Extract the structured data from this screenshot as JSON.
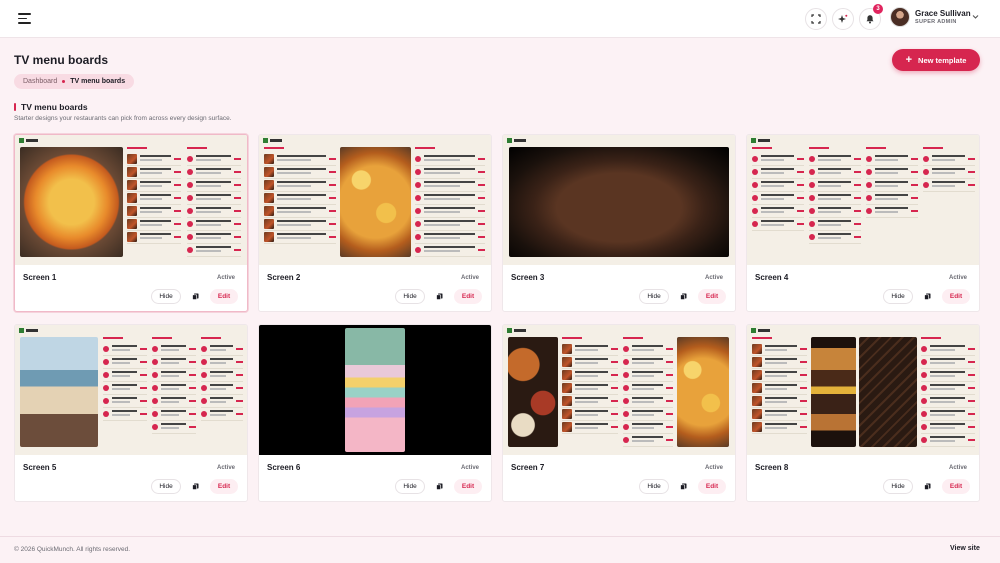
{
  "header": {
    "notification_count": "3",
    "user": {
      "name": "Grace Sullivan",
      "role": "SUPER ADMIN"
    }
  },
  "page": {
    "title": "TV menu boards",
    "new_template_label": "New template",
    "breadcrumb": {
      "parent": "Dashboard",
      "current": "TV menu boards"
    }
  },
  "section": {
    "title": "TV menu boards",
    "subtitle": "Starter designs your restaurants can pick from across every design surface."
  },
  "screens": [
    {
      "name": "Screen 1",
      "status": "Active",
      "hide_label": "Hide",
      "edit_label": "Edit",
      "selected": true
    },
    {
      "name": "Screen 2",
      "status": "Active",
      "hide_label": "Hide",
      "edit_label": "Edit"
    },
    {
      "name": "Screen 3",
      "status": "Active",
      "hide_label": "Hide",
      "edit_label": "Edit"
    },
    {
      "name": "Screen 4",
      "status": "Active",
      "hide_label": "Hide",
      "edit_label": "Edit"
    },
    {
      "name": "Screen 5",
      "status": "Active",
      "hide_label": "Hide",
      "edit_label": "Edit"
    },
    {
      "name": "Screen 6",
      "status": "Active",
      "hide_label": "Hide",
      "edit_label": "Edit"
    },
    {
      "name": "Screen 7",
      "status": "Active",
      "hide_label": "Hide",
      "edit_label": "Edit"
    },
    {
      "name": "Screen 8",
      "status": "Active",
      "hide_label": "Hide",
      "edit_label": "Edit"
    }
  ],
  "footer": {
    "copyright": "© 2026 QuickMunch. All rights reserved.",
    "view_site_label": "View site"
  },
  "colors": {
    "accent": "#d6264f",
    "background": "#fcf2f5"
  }
}
